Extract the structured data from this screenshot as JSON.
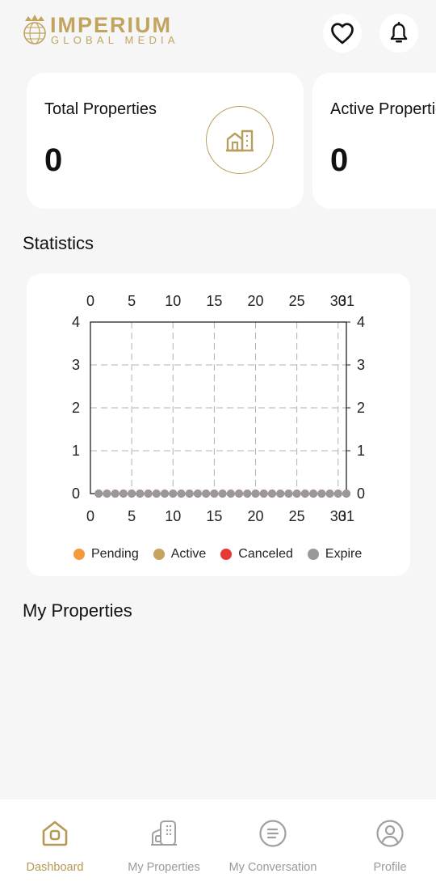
{
  "header": {
    "logo_word": "IMPERIUM",
    "logo_sub": "GLOBAL MEDIA",
    "favorites_icon": "heart-icon",
    "notifications_icon": "bell-icon"
  },
  "cards": [
    {
      "title": "Total Properties",
      "value": "0",
      "icon": "building-icon"
    },
    {
      "title": "Active Properties",
      "value": "0",
      "icon": "building-icon"
    }
  ],
  "statistics": {
    "title": "Statistics"
  },
  "my_properties": {
    "title": "My Properties"
  },
  "chart_data": {
    "type": "line",
    "x": [
      1,
      2,
      3,
      4,
      5,
      6,
      7,
      8,
      9,
      10,
      11,
      12,
      13,
      14,
      15,
      16,
      17,
      18,
      19,
      20,
      21,
      22,
      23,
      24,
      25,
      26,
      27,
      28,
      29,
      30,
      31
    ],
    "x_ticks": [
      "0",
      "5",
      "10",
      "15",
      "20",
      "25",
      "30",
      "31"
    ],
    "y_ticks": [
      "0",
      "1",
      "2",
      "3",
      "4"
    ],
    "xlim": [
      0,
      31
    ],
    "ylim": [
      0,
      4
    ],
    "grid": true,
    "series": [
      {
        "name": "Pending",
        "color": "#f59a3c",
        "values": [
          0,
          0,
          0,
          0,
          0,
          0,
          0,
          0,
          0,
          0,
          0,
          0,
          0,
          0,
          0,
          0,
          0,
          0,
          0,
          0,
          0,
          0,
          0,
          0,
          0,
          0,
          0,
          0,
          0,
          0,
          0
        ]
      },
      {
        "name": "Active",
        "color": "#c4a45e",
        "values": [
          0,
          0,
          0,
          0,
          0,
          0,
          0,
          0,
          0,
          0,
          0,
          0,
          0,
          0,
          0,
          0,
          0,
          0,
          0,
          0,
          0,
          0,
          0,
          0,
          0,
          0,
          0,
          0,
          0,
          0,
          0
        ]
      },
      {
        "name": "Canceled",
        "color": "#e53935",
        "values": [
          0,
          0,
          0,
          0,
          0,
          0,
          0,
          0,
          0,
          0,
          0,
          0,
          0,
          0,
          0,
          0,
          0,
          0,
          0,
          0,
          0,
          0,
          0,
          0,
          0,
          0,
          0,
          0,
          0,
          0,
          0
        ]
      },
      {
        "name": "Expire",
        "color": "#999999",
        "values": [
          0,
          0,
          0,
          0,
          0,
          0,
          0,
          0,
          0,
          0,
          0,
          0,
          0,
          0,
          0,
          0,
          0,
          0,
          0,
          0,
          0,
          0,
          0,
          0,
          0,
          0,
          0,
          0,
          0,
          0,
          0
        ]
      }
    ],
    "legend_position": "bottom"
  },
  "bottom_nav": [
    {
      "label": "Dashboard",
      "icon": "home-icon",
      "active": true
    },
    {
      "label": "My Properties",
      "icon": "buildings-icon",
      "active": false
    },
    {
      "label": "My Conversation",
      "icon": "chat-icon",
      "active": false
    },
    {
      "label": "Profile",
      "icon": "user-icon",
      "active": false
    }
  ],
  "colors": {
    "accent": "#c2a45f",
    "background": "#f5f6f5",
    "nav_inactive": "#9a9a9a"
  }
}
